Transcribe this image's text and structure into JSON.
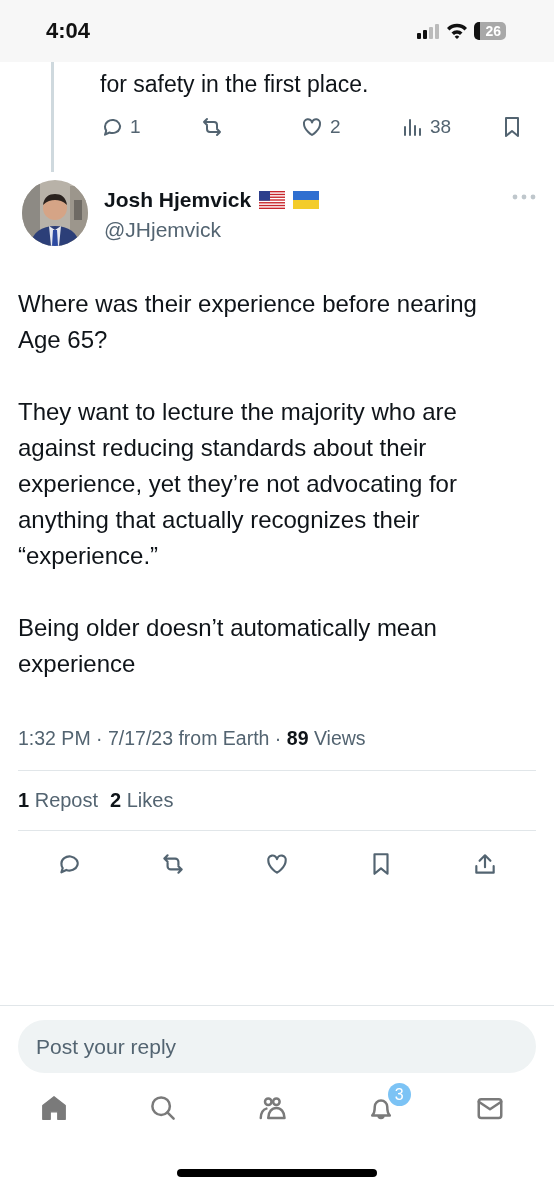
{
  "status_bar": {
    "time": "4:04",
    "battery": "26"
  },
  "previous_post": {
    "text_tail": "for safety in the first place.",
    "actions": [
      {
        "kind": "reply",
        "count": "1"
      },
      {
        "kind": "repost"
      },
      {
        "kind": "like",
        "count": "2"
      },
      {
        "kind": "views",
        "count": "38"
      },
      {
        "kind": "bookmark"
      }
    ]
  },
  "post": {
    "author": {
      "name": "Josh Hjemvick",
      "handle": "@JHjemvick"
    },
    "paragraphs": [
      "Where was their experience before nearing Age 65?",
      "They want to lecture the majority who are against reducing standards about their experience, yet they’re not advocating for anything that actually recognizes their “experience.”",
      "Being older doesn’t automatically mean experience"
    ],
    "meta": "1:32 PM · 7/17/23 from Earth · **89** Views",
    "stats": [
      "**1** Repost",
      "**2** Likes"
    ],
    "actions": [
      {
        "kind": "reply"
      },
      {
        "kind": "repost"
      },
      {
        "kind": "like"
      },
      {
        "kind": "bookmark"
      },
      {
        "kind": "share"
      }
    ]
  },
  "reply_bar": {
    "placeholder": "Post your reply"
  },
  "tab_bar": [
    {
      "kind": "home",
      "selected": true
    },
    {
      "kind": "search",
      "selected": false
    },
    {
      "kind": "communities",
      "selected": false
    },
    {
      "kind": "notifications",
      "selected": false,
      "badge": "3"
    },
    {
      "kind": "messages",
      "selected": false
    }
  ]
}
